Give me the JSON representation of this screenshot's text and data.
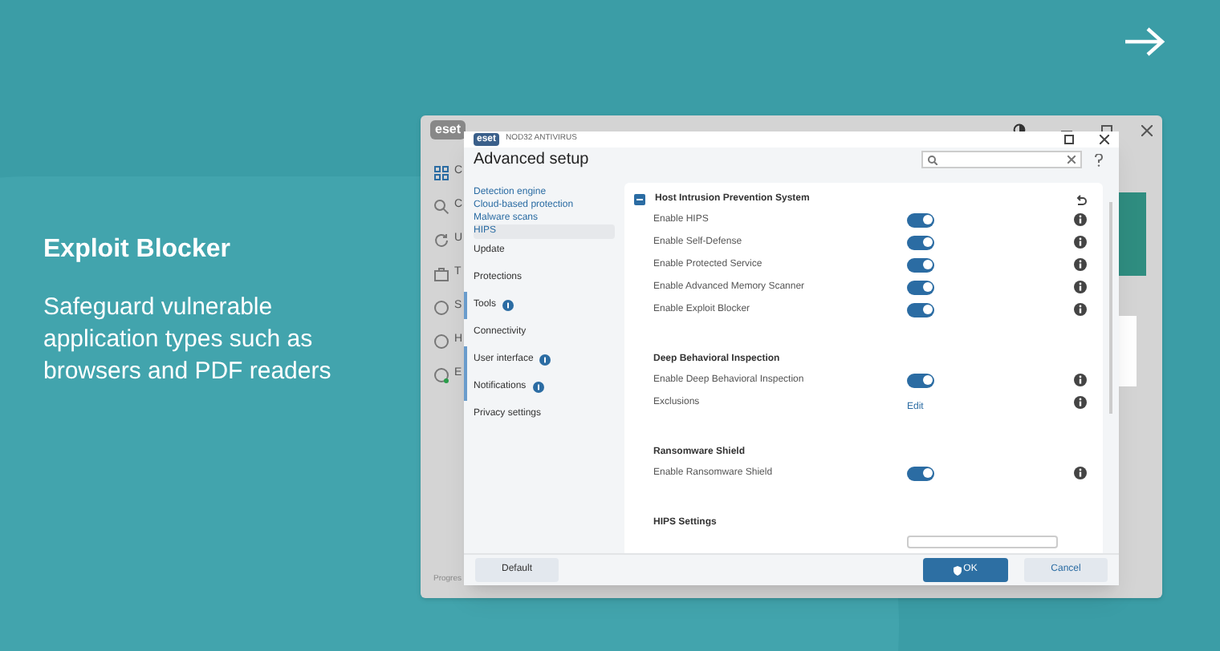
{
  "slide": {
    "title": "Exploit Blocker",
    "description": "Safeguard vulnerable application types such as browsers and PDF readers"
  },
  "background_window": {
    "logo": "eset",
    "sidebar_letters": [
      "C",
      "C",
      "U",
      "T",
      "S",
      "H",
      "E"
    ],
    "footer": "Progres"
  },
  "dialog": {
    "logo": "eset",
    "product": "NOD32 ANTIVIRUS",
    "title": "Advanced setup",
    "nav": [
      {
        "label": "Detection engine",
        "kind": "sub",
        "selected": false,
        "changed": false,
        "badge": false
      },
      {
        "label": "Cloud-based protection",
        "kind": "sub",
        "selected": false,
        "changed": false,
        "badge": false
      },
      {
        "label": "Malware scans",
        "kind": "sub",
        "selected": false,
        "changed": false,
        "badge": false
      },
      {
        "label": "HIPS",
        "kind": "sub",
        "selected": true,
        "changed": false,
        "badge": false
      },
      {
        "label": "Update",
        "kind": "top",
        "selected": false,
        "changed": false,
        "badge": false
      },
      {
        "label": "Protections",
        "kind": "top",
        "selected": false,
        "changed": false,
        "badge": false
      },
      {
        "label": "Tools",
        "kind": "top",
        "selected": false,
        "changed": true,
        "badge": true
      },
      {
        "label": "Connectivity",
        "kind": "top",
        "selected": false,
        "changed": false,
        "badge": false
      },
      {
        "label": "User interface",
        "kind": "top",
        "selected": false,
        "changed": true,
        "badge": true
      },
      {
        "label": "Notifications",
        "kind": "top",
        "selected": false,
        "changed": true,
        "badge": true
      },
      {
        "label": "Privacy settings",
        "kind": "top",
        "selected": false,
        "changed": false,
        "badge": false
      }
    ],
    "sections": [
      {
        "title": "Host Intrusion Prevention System",
        "expanded": true,
        "rows": [
          {
            "label": "Enable HIPS",
            "kind": "toggle",
            "on": true
          },
          {
            "label": "Enable Self-Defense",
            "kind": "toggle",
            "on": true
          },
          {
            "label": "Enable Protected Service",
            "kind": "toggle",
            "on": true
          },
          {
            "label": "Enable Advanced Memory Scanner",
            "kind": "toggle",
            "on": true
          },
          {
            "label": "Enable Exploit Blocker",
            "kind": "toggle",
            "on": true
          }
        ]
      },
      {
        "title": "Deep Behavioral Inspection",
        "rows": [
          {
            "label": "Enable Deep Behavioral Inspection",
            "kind": "toggle",
            "on": true
          },
          {
            "label": "Exclusions",
            "kind": "link",
            "link": "Edit"
          }
        ]
      },
      {
        "title": "Ransomware Shield",
        "rows": [
          {
            "label": "Enable Ransomware Shield",
            "kind": "toggle",
            "on": true
          }
        ]
      },
      {
        "title": "HIPS Settings"
      }
    ],
    "buttons": {
      "default": "Default",
      "ok": "OK",
      "cancel": "Cancel"
    }
  }
}
